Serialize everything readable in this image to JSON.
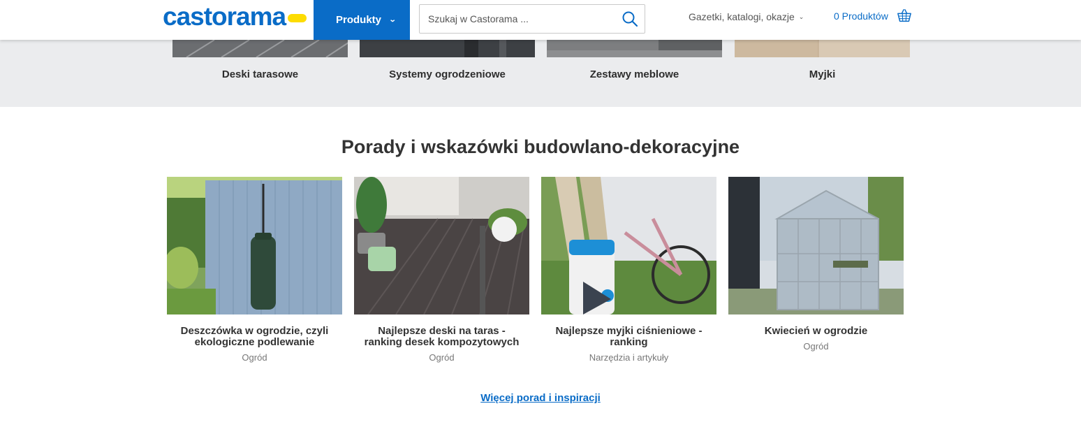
{
  "header": {
    "logo_text": "castorama",
    "products_label": "Produkty",
    "search_placeholder": "Szukaj w Castorama ...",
    "nav_link": "Gazetki, katalogi, okazje",
    "cart_label": "0 Produktów",
    "colors": {
      "brand_blue": "#0a6cc7",
      "brand_yellow": "#fddc02"
    }
  },
  "categories": [
    {
      "label": "Deski tarasowe"
    },
    {
      "label": "Systemy ogrodzeniowe"
    },
    {
      "label": "Zestawy meblowe"
    },
    {
      "label": "Myjki"
    }
  ],
  "advice": {
    "title": "Porady i wskazówki budowlano-dekoracyjne",
    "articles": [
      {
        "title": "Deszczówka w ogrodzie, czyli ekologiczne podlewanie",
        "category": "Ogród"
      },
      {
        "title": "Najlepsze deski na taras - ranking desek kompozytowych",
        "category": "Ogród"
      },
      {
        "title": "Najlepsze myjki ciśnieniowe - ranking",
        "category": "Narzędzia i artykuły"
      },
      {
        "title": "Kwiecień w ogrodzie",
        "category": "Ogród"
      }
    ],
    "more_link": "Więcej porad i inspiracji"
  }
}
